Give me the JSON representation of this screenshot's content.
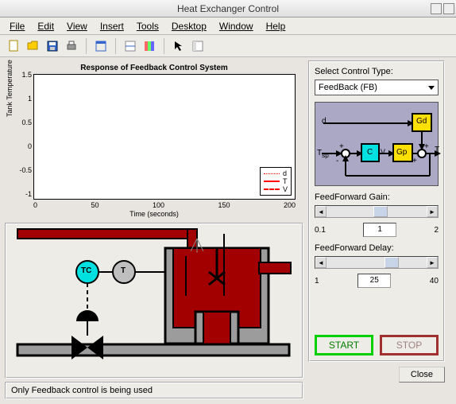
{
  "window": {
    "title": "Heat Exchanger Control"
  },
  "menu": {
    "file": "File",
    "edit": "Edit",
    "view": "View",
    "insert": "Insert",
    "tools": "Tools",
    "desktop": "Desktop",
    "window": "Window",
    "help": "Help"
  },
  "toolbar_icons": {
    "new": "new-file-icon",
    "open": "open-folder-icon",
    "save": "save-icon",
    "print": "print-icon",
    "layout": "layout-icon",
    "datacursor": "datacursor-icon",
    "colorbar": "colorbar-icon",
    "arrow": "arrow-icon",
    "gridplot": "gridplot-icon"
  },
  "chart_data": {
    "type": "line",
    "title": "Response of Feedback Control System",
    "xlabel": "Time (seconds)",
    "ylabel": "Tank Temperature",
    "xlim": [
      0,
      200
    ],
    "ylim": [
      -1,
      1.5
    ],
    "xticks": [
      0,
      50,
      100,
      150,
      200
    ],
    "yticks": [
      -1,
      -0.5,
      0,
      0.5,
      1,
      1.5
    ],
    "series": [
      {
        "name": "d",
        "style": "dotted-red",
        "values": []
      },
      {
        "name": "T",
        "style": "solid-red",
        "values": []
      },
      {
        "name": "V",
        "style": "dashed-red",
        "values": []
      }
    ]
  },
  "diagram": {
    "tc_label": "TC",
    "t_label": "T"
  },
  "status": {
    "text": "Only Feedback control is being used"
  },
  "controls": {
    "select_label": "Select Control Type:",
    "select_value": "FeedBack (FB)",
    "block": {
      "d": "d",
      "Gd": "Gd",
      "C": "C",
      "Gp": "Gp",
      "Tsp": "T",
      "Tsp_sub": "sp",
      "T": "T",
      "V": "V"
    },
    "gain": {
      "label": "FeedForward Gain:",
      "min": "0.1",
      "max": "2",
      "value": "1",
      "thumb_pct": 47
    },
    "delay": {
      "label": "FeedForward Delay:",
      "min": "1",
      "max": "40",
      "value": "25",
      "thumb_pct": 58
    },
    "start": "START",
    "stop": "STOP",
    "close": "Close"
  }
}
